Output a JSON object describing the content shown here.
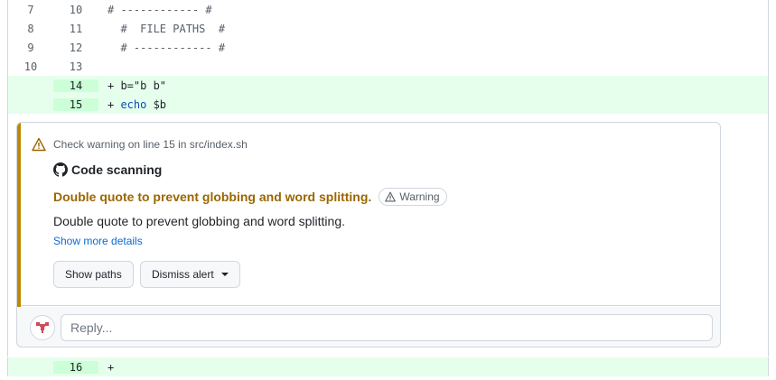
{
  "diff_lines": [
    {
      "old": "7",
      "new": "10",
      "code": "# ------------ #",
      "type": "context"
    },
    {
      "old": "8",
      "new": "11",
      "code": "  #  FILE PATHS  #",
      "type": "context"
    },
    {
      "old": "9",
      "new": "12",
      "code": "  # ------------ #",
      "type": "context"
    },
    {
      "old": "10",
      "new": "13",
      "code": "",
      "type": "context"
    },
    {
      "old": "",
      "new": "14",
      "code_prefix": "+ ",
      "code": "b=\"b b\"",
      "type": "add"
    },
    {
      "old": "",
      "new": "15",
      "code_prefix": "+ ",
      "code_kw": "echo",
      "code": " $b",
      "type": "add"
    }
  ],
  "alert": {
    "location": "Check warning on line 15 in src/index.sh",
    "tool": "Code scanning",
    "title": "Double quote to prevent globbing and word splitting.",
    "severity": "Warning",
    "description": "Double quote to prevent globbing and word splitting.",
    "more_link": "Show more details",
    "show_paths": "Show paths",
    "dismiss": "Dismiss alert",
    "accent_color": "#bf8700"
  },
  "reply": {
    "placeholder": "Reply..."
  },
  "trailing_line": {
    "old": "",
    "new": "16",
    "code": "+",
    "type": "add"
  },
  "icons": [
    "alert-icon",
    "github-mark-icon",
    "avatar-identicon"
  ]
}
